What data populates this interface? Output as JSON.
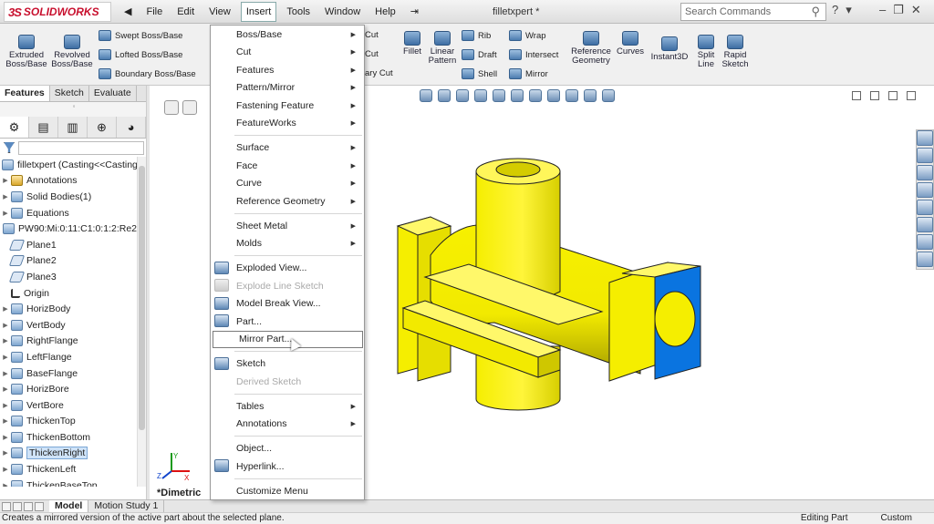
{
  "app": {
    "logo": "SOLIDWORKS",
    "logo_prefix": "3S",
    "doc_title": "filletxpert *"
  },
  "menubar": {
    "items": [
      "File",
      "Edit",
      "View",
      "Insert",
      "Tools",
      "Window",
      "Help"
    ],
    "pin": "⇥"
  },
  "search": {
    "placeholder": "Search Commands"
  },
  "ribbon": {
    "large": [
      {
        "label1": "Extruded",
        "label2": "Boss/Base"
      },
      {
        "label1": "Revolved",
        "label2": "Boss/Base"
      }
    ],
    "small_left": [
      "Swept Boss/Base",
      "Lofted Boss/Base",
      "Boundary Boss/Base"
    ],
    "behind_menu": [
      "Cut",
      "Cut",
      "ary Cut"
    ],
    "right": [
      {
        "label1": "Fillet",
        "label2": ""
      },
      {
        "label1": "Linear",
        "label2": "Pattern"
      },
      {
        "label1": "Reference",
        "label2": "Geometry"
      },
      {
        "label1": "Curves",
        "label2": ""
      },
      {
        "label1": "Instant3D",
        "label2": ""
      },
      {
        "label1": "Split",
        "label2": "Line"
      },
      {
        "label1": "Rapid",
        "label2": "Sketch"
      }
    ],
    "small_mid": [
      "Rib",
      "Draft",
      "Shell",
      "Wrap",
      "Intersect",
      "Mirror"
    ]
  },
  "cm_tabs": [
    "Features",
    "Sketch",
    "Evaluate"
  ],
  "tree": {
    "root": "filletxpert  (Casting<<Casting>",
    "items": [
      {
        "label": "Annotations",
        "icon": "annotations-icon",
        "arrow": true
      },
      {
        "label": "Solid Bodies(1)",
        "icon": "solid-bodies-icon",
        "arrow": true
      },
      {
        "label": "Equations",
        "icon": "equations-icon",
        "arrow": true
      },
      {
        "label": "PW90:Mi:0:11:C1:0:1:2:Re2",
        "icon": "material-icon",
        "arrow": false
      },
      {
        "label": "Plane1",
        "icon": "plane-icon",
        "arrow": false
      },
      {
        "label": "Plane2",
        "icon": "plane-icon",
        "arrow": false
      },
      {
        "label": "Plane3",
        "icon": "plane-icon",
        "arrow": false
      },
      {
        "label": "Origin",
        "icon": "origin-icon",
        "arrow": false
      },
      {
        "label": "HorizBody",
        "icon": "feature-icon",
        "arrow": true
      },
      {
        "label": "VertBody",
        "icon": "feature-icon",
        "arrow": true
      },
      {
        "label": "RightFlange",
        "icon": "feature-icon",
        "arrow": true
      },
      {
        "label": "LeftFlange",
        "icon": "feature-icon",
        "arrow": true
      },
      {
        "label": "BaseFlange",
        "icon": "feature-icon",
        "arrow": true
      },
      {
        "label": "HorizBore",
        "icon": "feature-icon",
        "arrow": true
      },
      {
        "label": "VertBore",
        "icon": "feature-icon",
        "arrow": true
      },
      {
        "label": "ThickenTop",
        "icon": "feature-icon",
        "arrow": true
      },
      {
        "label": "ThickenBottom",
        "icon": "feature-icon",
        "arrow": true
      },
      {
        "label": "ThickenRight",
        "icon": "feature-icon",
        "arrow": true,
        "selected": true
      },
      {
        "label": "ThickenLeft",
        "icon": "feature-icon",
        "arrow": true
      },
      {
        "label": "ThickenBaseTop",
        "icon": "feature-icon",
        "arrow": true
      }
    ]
  },
  "insert_menu": [
    {
      "label": "Boss/Base",
      "submenu": true
    },
    {
      "label": "Cut",
      "submenu": true
    },
    {
      "label": "Features",
      "submenu": true
    },
    {
      "label": "Pattern/Mirror",
      "submenu": true
    },
    {
      "label": "Fastening Feature",
      "submenu": true
    },
    {
      "label": "FeatureWorks",
      "submenu": true
    },
    {
      "sep": true
    },
    {
      "label": "Surface",
      "submenu": true
    },
    {
      "label": "Face",
      "submenu": true
    },
    {
      "label": "Curve",
      "submenu": true
    },
    {
      "label": "Reference Geometry",
      "submenu": true
    },
    {
      "sep": true
    },
    {
      "label": "Sheet Metal",
      "submenu": true
    },
    {
      "label": "Molds",
      "submenu": true
    },
    {
      "sep": true
    },
    {
      "label": "Exploded View...",
      "icon": "exploded-view-icon"
    },
    {
      "label": "Explode Line Sketch",
      "icon": "explode-line-icon",
      "disabled": true
    },
    {
      "label": "Model Break View...",
      "icon": "model-break-icon"
    },
    {
      "label": "Part...",
      "icon": "part-icon"
    },
    {
      "label": "Mirror Part...",
      "highlighted": true
    },
    {
      "sep": true
    },
    {
      "label": "Sketch",
      "icon": "sketch-icon"
    },
    {
      "label": "Derived Sketch",
      "disabled": true
    },
    {
      "sep": true
    },
    {
      "label": "Tables",
      "submenu": true
    },
    {
      "label": "Annotations",
      "submenu": true
    },
    {
      "sep": true
    },
    {
      "label": "Object..."
    },
    {
      "label": "Hyperlink...",
      "icon": "hyperlink-icon"
    },
    {
      "sep": true
    },
    {
      "label": "Customize Menu"
    }
  ],
  "viewport": {
    "view_name": "*Dimetric",
    "triad": {
      "x": "X",
      "y": "Y",
      "z": "Z"
    }
  },
  "bottom_tabs": [
    "Model",
    "Motion Study 1"
  ],
  "status": {
    "message": "Creates a mirrored version of the active part about the selected plane.",
    "mode": "Editing Part",
    "units": "Custom"
  },
  "colors": {
    "part_yellow": "#f5ee00",
    "face_blue": "#0a74e0",
    "brand_red": "#c8102e"
  }
}
